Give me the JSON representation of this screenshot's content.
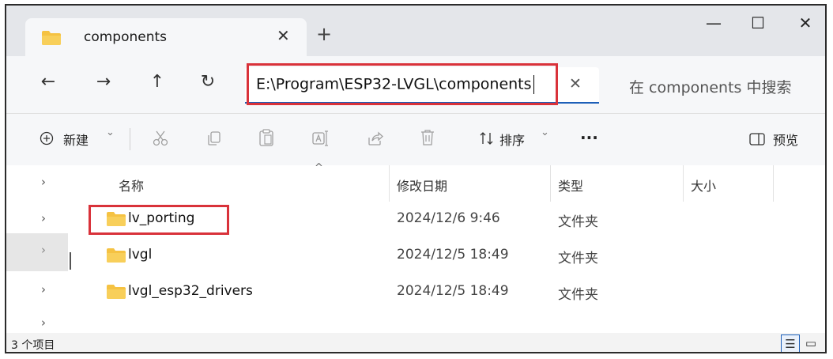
{
  "tab": {
    "label": "components",
    "close_glyph": "✕",
    "new_tab_glyph": "+"
  },
  "window_controls": {
    "minimize_glyph": "—",
    "maximize_glyph": "☐",
    "close_glyph": "✕"
  },
  "nav": {
    "back_glyph": "←",
    "forward_glyph": "→",
    "up_glyph": "↑",
    "refresh_glyph": "↻",
    "address": "E:\\Program\\ESP32-LVGL\\components",
    "clear_glyph": "✕",
    "search_placeholder": "在 components 中搜索"
  },
  "command_bar": {
    "new_label": "新建",
    "new_chevron": "⌄",
    "cut_icon": "scissors-icon",
    "copy_icon": "copy-icon",
    "paste_icon": "paste-icon",
    "rename_icon": "rename-icon",
    "share_icon": "share-icon",
    "delete_icon": "trash-icon",
    "sort_label": "排序",
    "sort_chevron": "⌄",
    "more_label": "···",
    "preview_label": "预览"
  },
  "columns": {
    "name": "名称",
    "modified": "修改日期",
    "type": "类型",
    "size": "大小"
  },
  "files": [
    {
      "name": "lv_porting",
      "modified": "2024/12/6 9:46",
      "type": "文件夹"
    },
    {
      "name": "lvgl",
      "modified": "2024/12/5 18:49",
      "type": "文件夹"
    },
    {
      "name": "lvgl_esp32_drivers",
      "modified": "2024/12/5 18:49",
      "type": "文件夹"
    }
  ],
  "status": {
    "item_count": "3 个项目"
  },
  "colors": {
    "highlight_red": "#d9323a",
    "accent_blue": "#1d5fb8",
    "folder_yellow": "#f5c242"
  }
}
